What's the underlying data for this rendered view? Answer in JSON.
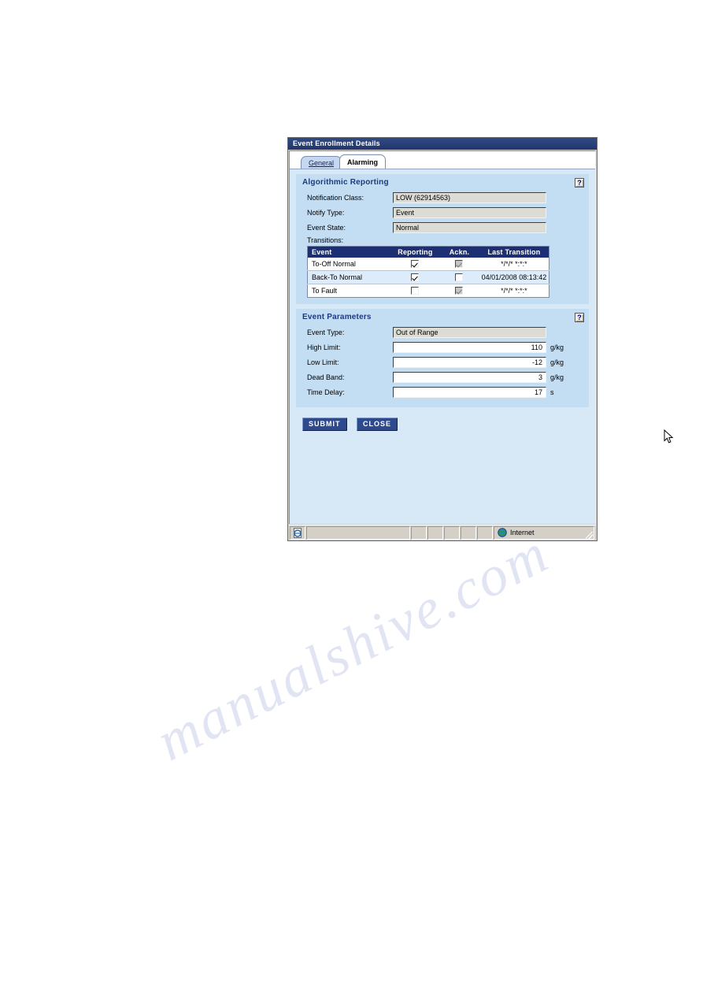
{
  "watermark": {
    "line1": "manualshive.com",
    "line2": "ve.com"
  },
  "window": {
    "title": "Event Enrollment Details",
    "tabs": [
      {
        "label": "General",
        "active": false
      },
      {
        "label": "Alarming",
        "active": true
      }
    ]
  },
  "algorithmic_reporting": {
    "title": "Algorithmic Reporting",
    "help_label": "?",
    "fields": [
      {
        "label": "Notification Class:",
        "value": "LOW (62914563)"
      },
      {
        "label": "Notify Type:",
        "value": "Event"
      },
      {
        "label": "Event State:",
        "value": "Normal"
      }
    ],
    "transitions_label": "Transitions:",
    "table": {
      "headers": [
        "Event",
        "Reporting",
        "Ackn.",
        "Last Transition"
      ],
      "rows": [
        {
          "event": "To-Off Normal",
          "reporting": true,
          "reporting_disabled": false,
          "ackn": true,
          "ackn_disabled": true,
          "last_transition": "*/*/* *:*:*",
          "highlight": false
        },
        {
          "event": "Back-To Normal",
          "reporting": true,
          "reporting_disabled": false,
          "ackn": false,
          "ackn_disabled": false,
          "last_transition": "04/01/2008 08:13:42",
          "highlight": true
        },
        {
          "event": "To Fault",
          "reporting": false,
          "reporting_disabled": false,
          "ackn": true,
          "ackn_disabled": true,
          "last_transition": "*/*/* *:*:*",
          "highlight": false
        }
      ]
    }
  },
  "event_parameters": {
    "title": "Event Parameters",
    "help_label": "?",
    "fields": [
      {
        "label": "Event Type:",
        "value": "Out of Range",
        "unit": "",
        "editable": false
      },
      {
        "label": "High Limit:",
        "value": "110",
        "unit": "g/kg",
        "editable": true
      },
      {
        "label": "Low Limit:",
        "value": "-12",
        "unit": "g/kg",
        "editable": true
      },
      {
        "label": "Dead Band:",
        "value": "3",
        "unit": "g/kg",
        "editable": true
      },
      {
        "label": "Time Delay:",
        "value": "17",
        "unit": "s",
        "editable": true
      }
    ]
  },
  "actions": {
    "submit_label": "SUBMIT",
    "close_label": "CLOSE"
  },
  "statusbar": {
    "zone_label": "Internet",
    "zone_icon": "globe-icon",
    "app_icon": "ie-document-icon"
  },
  "colors": {
    "titlebar": "#23356b",
    "panel": "#c3ddf3",
    "content": "#d7e8f7",
    "header_row": "#1d2f74",
    "accent_text": "#1d3a80",
    "button": "#2e4a8e"
  }
}
